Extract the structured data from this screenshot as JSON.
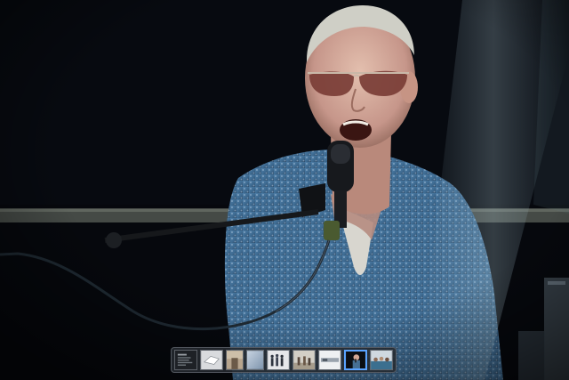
{
  "viewer": {
    "image_subject": "man-singing-at-microphone",
    "background_color": "#05070b",
    "accent_color": "#5aa3ff"
  },
  "filmstrip": {
    "selected_index": 7,
    "thumbnails": [
      {
        "icon": "thumbnail-dark-document"
      },
      {
        "icon": "thumbnail-white-shape"
      },
      {
        "icon": "thumbnail-room"
      },
      {
        "icon": "thumbnail-blue-gradient"
      },
      {
        "icon": "thumbnail-group-photo"
      },
      {
        "icon": "thumbnail-people-outdoor"
      },
      {
        "icon": "thumbnail-wide-light"
      },
      {
        "icon": "thumbnail-singer"
      },
      {
        "icon": "thumbnail-crowd"
      }
    ]
  }
}
